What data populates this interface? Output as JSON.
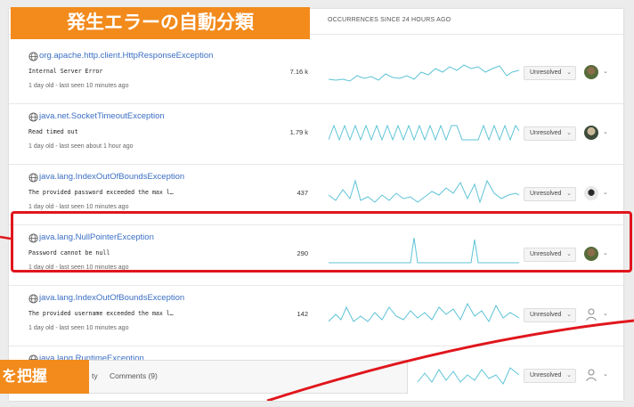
{
  "banner": {
    "title": "発生エラーの自動分類",
    "bottom_text": "を把握"
  },
  "column_header": "OCCURRENCES SINCE 24 HOURS AGO",
  "issues": [
    {
      "type": "org.apache.http.client.HttpResponseException",
      "message": "Internal Server Error",
      "count": "7.16 k",
      "meta": "1 day old - last seen 10 minutes ago",
      "status": "Unresolved",
      "assignee": "avatar"
    },
    {
      "type": "java.net.SocketTimeoutException",
      "message": "Read timed out",
      "count": "1.79 k",
      "meta": "1 day old - last seen about 1 hour ago",
      "status": "Unresolved",
      "assignee": "avatar"
    },
    {
      "type": "java.lang.IndexOutOfBoundsException",
      "message": "The provided password exceeded the max l…",
      "count": "437",
      "meta": "1 day old - last seen 10 minutes ago",
      "status": "Unresolved",
      "assignee": "avatar"
    },
    {
      "type": "java.lang.NullPointerException",
      "message": "Password cannot be null",
      "count": "290",
      "meta": "1 day old - last seen 10 minutes ago",
      "status": "Unresolved",
      "assignee": "avatar"
    },
    {
      "type": "java.lang.IndexOutOfBoundsException",
      "message": "The provided username exceeded the max l…",
      "count": "142",
      "meta": "1 day old - last seen 10 minutes ago",
      "status": "Unresolved",
      "assignee": "person-icon"
    },
    {
      "type": "java.lang.RuntimeException",
      "message": "",
      "count": "",
      "meta": "",
      "status": "Unresolved",
      "assignee": "person-icon"
    }
  ],
  "tabs": {
    "activity_partial": "ty",
    "comments": "Comments (9)"
  },
  "colors": {
    "accent_orange": "#f28a1c",
    "highlight_red": "#e0161d",
    "spark": "#5ec3d6",
    "link": "#3b6fc4"
  }
}
